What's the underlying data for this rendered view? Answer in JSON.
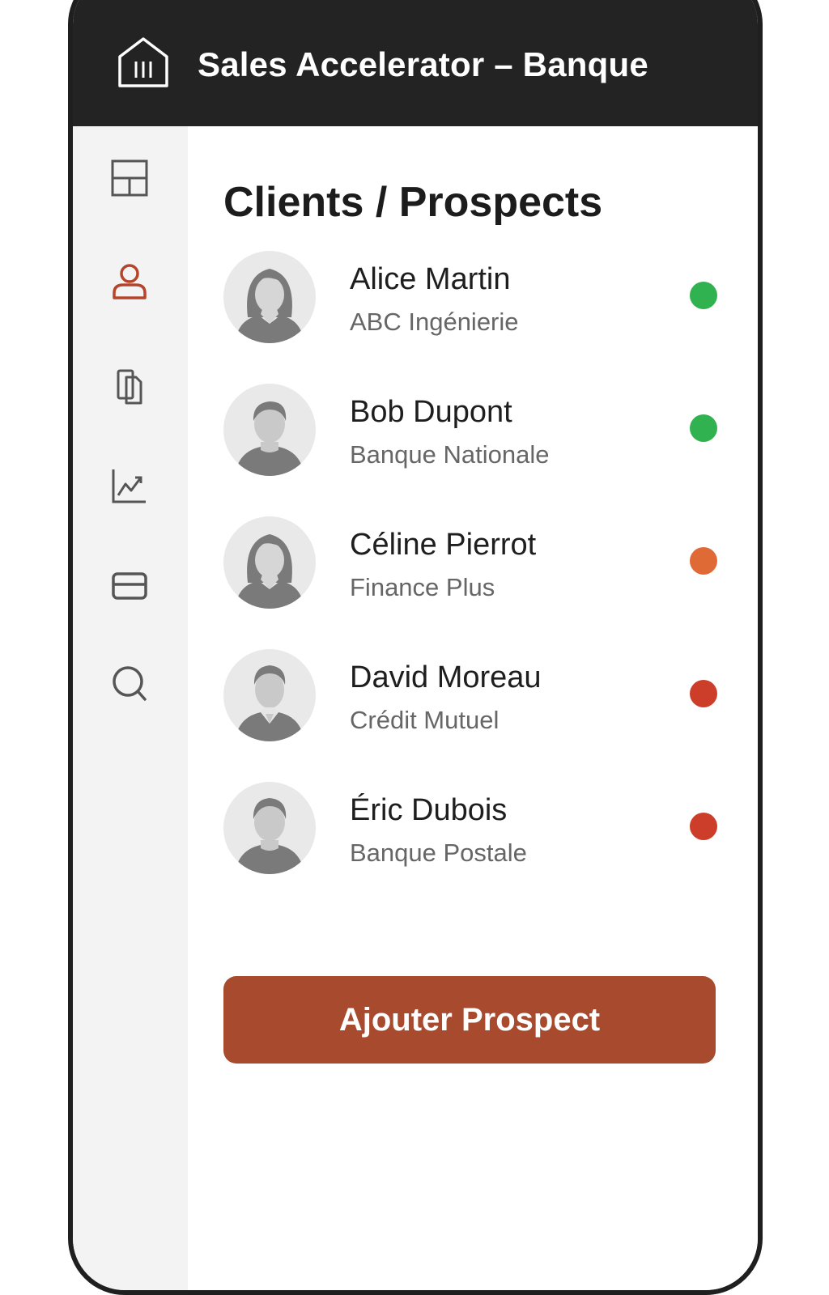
{
  "header": {
    "title": "Sales Accelerator – Banque",
    "icon": "bank-icon"
  },
  "sidebar": {
    "items": [
      {
        "icon": "dashboard-icon",
        "active": false
      },
      {
        "icon": "user-icon",
        "active": true
      },
      {
        "icon": "documents-icon",
        "active": false
      },
      {
        "icon": "analytics-chart-icon",
        "active": false
      },
      {
        "icon": "credit-card-icon",
        "active": false
      },
      {
        "icon": "search-icon",
        "active": false
      }
    ]
  },
  "main": {
    "title": "Clients / Prospects",
    "clients": [
      {
        "name": "Alice Martin",
        "company": "ABC Ingénierie",
        "avatar": "female-avatar",
        "status_color": "#2fb24f"
      },
      {
        "name": "Bob Dupont",
        "company": "Banque Nationale",
        "avatar": "male-avatar",
        "status_color": "#2fb24f"
      },
      {
        "name": "Céline Pierrot",
        "company": "Finance Plus",
        "avatar": "female-avatar",
        "status_color": "#e06a35"
      },
      {
        "name": "David Moreau",
        "company": "Crédit Mutuel",
        "avatar": "male-avatar",
        "status_color": "#cc3e2a"
      },
      {
        "name": "Éric Dubois",
        "company": "Banque Postale",
        "avatar": "male-avatar",
        "status_color": "#cc3e2a"
      }
    ],
    "add_button_label": "Ajouter Prospect"
  },
  "colors": {
    "header_bg": "#232323",
    "accent": "#a84a2e",
    "active_icon": "#b5442a",
    "inactive_icon": "#555555",
    "sidebar_bg": "#f3f3f3"
  }
}
